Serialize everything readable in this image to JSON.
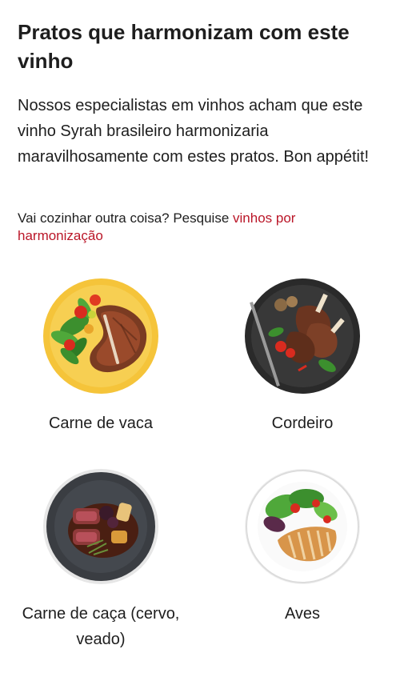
{
  "section": {
    "title": "Pratos que harmonizam com este vinho",
    "intro": "Nossos especialistas em vinhos acham que este vinho Syrah brasileiro harmonizaria maravilhosamente com estes pratos. Bon appétit!",
    "search_prefix": "Vai cozinhar outra coisa? Pesquise ",
    "search_link": "vinhos por harmonização"
  },
  "dishes": [
    {
      "label": "Carne de vaca",
      "image": "steak-plate"
    },
    {
      "label": "Cordeiro",
      "image": "lamb-chops-plate"
    },
    {
      "label": "Carne de caça (cervo, veado)",
      "image": "venison-plate"
    },
    {
      "label": "Aves",
      "image": "chicken-salad-plate"
    }
  ],
  "colors": {
    "text": "#1e1e1e",
    "link": "#ba1628"
  }
}
